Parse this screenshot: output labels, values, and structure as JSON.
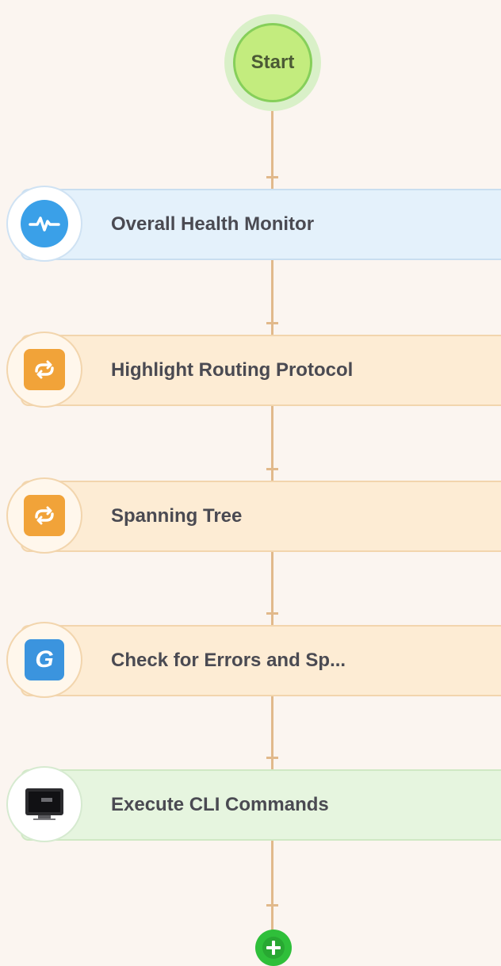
{
  "flow": {
    "start_label": "Start",
    "steps": [
      {
        "label": "Overall Health Monitor",
        "icon": "health-monitor-icon",
        "color": "#e4f1fb"
      },
      {
        "label": "Highlight Routing Protocol",
        "icon": "loop-icon",
        "color": "#fdecd4"
      },
      {
        "label": "Spanning Tree",
        "icon": "loop-icon",
        "color": "#fdecd4"
      },
      {
        "label": "Check for Errors and Sp...",
        "icon": "g-icon",
        "color": "#fdecd4"
      },
      {
        "label": "Execute CLI Commands",
        "icon": "cli-terminal-icon",
        "color": "#e6f5df"
      }
    ],
    "add_icon": "plus-icon",
    "colors": {
      "connector": "#e1b98b",
      "start": "#c3ec7e",
      "add": "#2fbf3a"
    }
  }
}
